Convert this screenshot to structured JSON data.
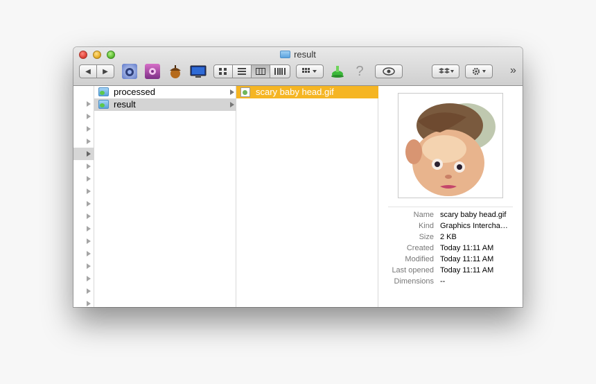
{
  "window": {
    "title": "result"
  },
  "toolbar": {
    "back_label": "◀",
    "forward_label": "▶",
    "more_label": "»",
    "help_label": "?"
  },
  "column1": {
    "items": [
      {
        "label": "processed",
        "icon": "folder-icon"
      },
      {
        "label": "result",
        "icon": "folder-icon"
      }
    ]
  },
  "column2": {
    "items": [
      {
        "label": "scary baby head.gif",
        "icon": "gif-file-icon"
      }
    ]
  },
  "info": {
    "rows": [
      {
        "key": "Name",
        "value": "scary baby head.gif"
      },
      {
        "key": "Kind",
        "value": "Graphics Intercha…"
      },
      {
        "key": "Size",
        "value": "2 KB"
      },
      {
        "key": "Created",
        "value": "Today 11:11 AM"
      },
      {
        "key": "Modified",
        "value": "Today 11:11 AM"
      },
      {
        "key": "Last opened",
        "value": "Today 11:11 AM"
      },
      {
        "key": "Dimensions",
        "value": "--"
      }
    ]
  },
  "colors": {
    "selection": "#f5b523",
    "folder": "#5aa2dc"
  }
}
